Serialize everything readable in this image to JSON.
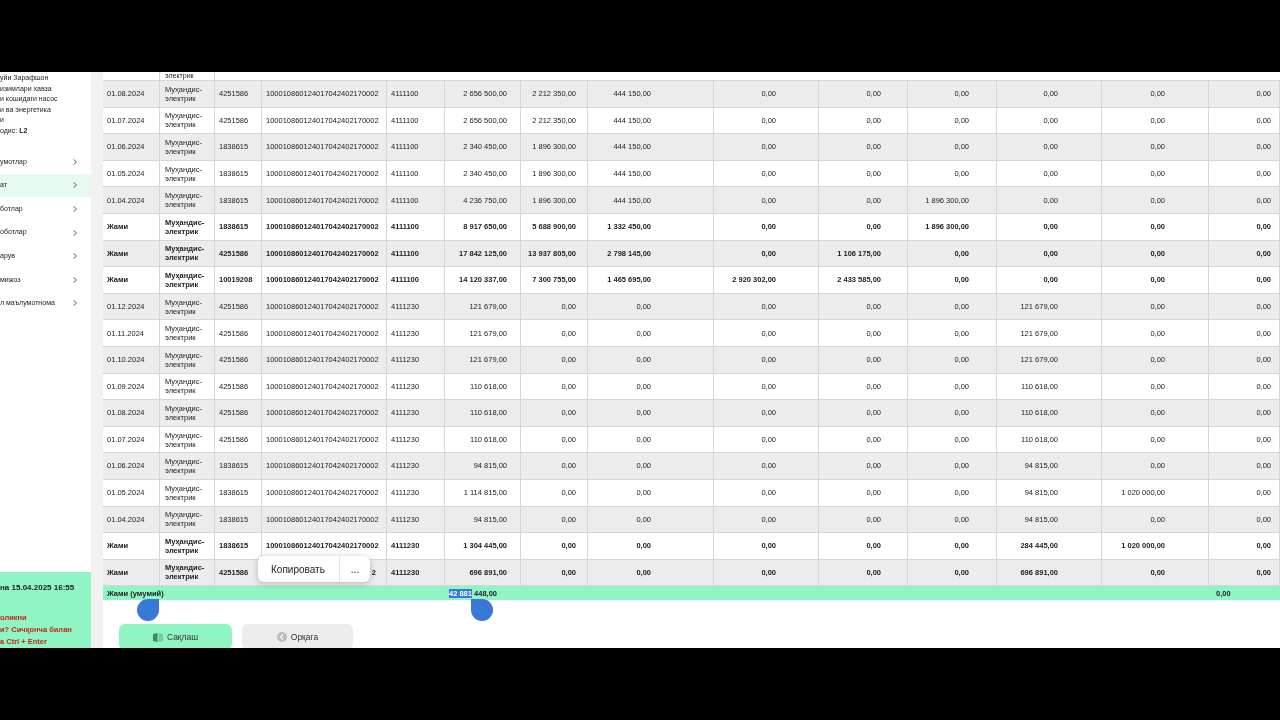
{
  "sidebar": {
    "header_lines": [
      "уйи Зарафшон",
      "изимлари хавза",
      "и кошидаги насос",
      "и ва энергетика",
      "и",
      "одис: **L2**"
    ],
    "items": [
      {
        "label": "умотлар",
        "selected": false
      },
      {
        "label": "ат",
        "selected": true
      },
      {
        "label": "ботлар",
        "selected": false
      },
      {
        "label": "оботлар",
        "selected": false
      },
      {
        "label": "арув",
        "selected": false
      },
      {
        "label": "мижоз",
        "selected": false
      },
      {
        "label": "л маълумотнома",
        "selected": false
      }
    ],
    "footer": {
      "timestamp": "на 15.04.2025 16:55",
      "hint_lines": [
        "оликни",
        "и? Сичқонча билан",
        "а Ctrl + Enter"
      ]
    }
  },
  "table": {
    "top_fragment": "электрик",
    "rows": [
      {
        "date": "01.08.2024",
        "position": "Муҳандис-электрик",
        "id": "4251586",
        "account": "100010860124017042402170002",
        "code": "4111100",
        "bold": false,
        "values": [
          "2 656 500,00",
          "2 212 350,00",
          "444 150,00",
          "0,00",
          "0,00",
          "0,00",
          "0,00",
          "0,00",
          "0,00"
        ]
      },
      {
        "date": "01.07.2024",
        "position": "Муҳандис-электрик",
        "id": "4251586",
        "account": "100010860124017042402170002",
        "code": "4111100",
        "bold": false,
        "values": [
          "2 656 500,00",
          "2 212 350,00",
          "444 150,00",
          "0,00",
          "0,00",
          "0,00",
          "0,00",
          "0,00",
          "0,00"
        ]
      },
      {
        "date": "01.06.2024",
        "position": "Муҳандис-электрик",
        "id": "1838615",
        "account": "100010860124017042402170002",
        "code": "4111100",
        "bold": false,
        "values": [
          "2 340 450,00",
          "1 896 300,00",
          "444 150,00",
          "0,00",
          "0,00",
          "0,00",
          "0,00",
          "0,00",
          "0,00"
        ]
      },
      {
        "date": "01.05.2024",
        "position": "Муҳандис-электрик",
        "id": "1838615",
        "account": "100010860124017042402170002",
        "code": "4111100",
        "bold": false,
        "values": [
          "2 340 450,00",
          "1 896 300,00",
          "444 150,00",
          "0,00",
          "0,00",
          "0,00",
          "0,00",
          "0,00",
          "0,00"
        ]
      },
      {
        "date": "01.04.2024",
        "position": "Муҳандис-электрик",
        "id": "1838615",
        "account": "100010860124017042402170002",
        "code": "4111100",
        "bold": false,
        "values": [
          "4 236 750,00",
          "1 896 300,00",
          "444 150,00",
          "0,00",
          "0,00",
          "1 896 300,00",
          "0,00",
          "0,00",
          "0,00"
        ]
      },
      {
        "date": "Жами",
        "position": "Муҳандис-электрик",
        "id": "1838615",
        "account": "100010860124017042402170002",
        "code": "4111100",
        "bold": true,
        "values": [
          "8 917 650,00",
          "5 688 900,00",
          "1 332 450,00",
          "0,00",
          "0,00",
          "1 896 300,00",
          "0,00",
          "0,00",
          "0,00"
        ]
      },
      {
        "date": "Жами",
        "position": "Муҳандис-электрик",
        "id": "4251586",
        "account": "100010860124017042402170002",
        "code": "4111100",
        "bold": true,
        "values": [
          "17 842 125,00",
          "13 937 805,00",
          "2 798 145,00",
          "0,00",
          "1 106 175,00",
          "0,00",
          "0,00",
          "0,00",
          "0,00"
        ]
      },
      {
        "date": "Жами",
        "position": "Муҳандис-электрик",
        "id": "10019208",
        "account": "100010860124017042402170002",
        "code": "4111100",
        "bold": true,
        "values": [
          "14 120 337,00",
          "7 300 755,00",
          "1 465 695,00",
          "2 920 302,00",
          "2 433 585,00",
          "0,00",
          "0,00",
          "0,00",
          "0,00"
        ]
      },
      {
        "date": "01.12.2024",
        "position": "Муҳандис-электрик",
        "id": "4251586",
        "account": "100010860124017042402170002",
        "code": "4111230",
        "bold": false,
        "values": [
          "121 679,00",
          "0,00",
          "0,00",
          "0,00",
          "0,00",
          "0,00",
          "121 679,00",
          "0,00",
          "0,00"
        ]
      },
      {
        "date": "01.11.2024",
        "position": "Муҳандис-электрик",
        "id": "4251586",
        "account": "100010860124017042402170002",
        "code": "4111230",
        "bold": false,
        "values": [
          "121 679,00",
          "0,00",
          "0,00",
          "0,00",
          "0,00",
          "0,00",
          "121 679,00",
          "0,00",
          "0,00"
        ]
      },
      {
        "date": "01.10.2024",
        "position": "Муҳандис-электрик",
        "id": "4251586",
        "account": "100010860124017042402170002",
        "code": "4111230",
        "bold": false,
        "values": [
          "121 679,00",
          "0,00",
          "0,00",
          "0,00",
          "0,00",
          "0,00",
          "121 679,00",
          "0,00",
          "0,00"
        ]
      },
      {
        "date": "01.09.2024",
        "position": "Муҳандис-электрик",
        "id": "4251586",
        "account": "100010860124017042402170002",
        "code": "4111230",
        "bold": false,
        "values": [
          "110 618,00",
          "0,00",
          "0,00",
          "0,00",
          "0,00",
          "0,00",
          "110 618,00",
          "0,00",
          "0,00"
        ]
      },
      {
        "date": "01.08.2024",
        "position": "Муҳандис-электрик",
        "id": "4251586",
        "account": "100010860124017042402170002",
        "code": "4111230",
        "bold": false,
        "values": [
          "110 618,00",
          "0,00",
          "0,00",
          "0,00",
          "0,00",
          "0,00",
          "110 618,00",
          "0,00",
          "0,00"
        ]
      },
      {
        "date": "01.07.2024",
        "position": "Муҳандис-электрик",
        "id": "4251586",
        "account": "100010860124017042402170002",
        "code": "4111230",
        "bold": false,
        "values": [
          "110 618,00",
          "0,00",
          "0,00",
          "0,00",
          "0,00",
          "0,00",
          "110 618,00",
          "0,00",
          "0,00"
        ]
      },
      {
        "date": "01.06.2024",
        "position": "Муҳандис-электрик",
        "id": "1838615",
        "account": "100010860124017042402170002",
        "code": "4111230",
        "bold": false,
        "values": [
          "94 815,00",
          "0,00",
          "0,00",
          "0,00",
          "0,00",
          "0,00",
          "94 815,00",
          "0,00",
          "0,00"
        ]
      },
      {
        "date": "01.05.2024",
        "position": "Муҳандис-электрик",
        "id": "1838615",
        "account": "100010860124017042402170002",
        "code": "4111230",
        "bold": false,
        "values": [
          "1 114 815,00",
          "0,00",
          "0,00",
          "0,00",
          "0,00",
          "0,00",
          "94 815,00",
          "1 020 000,00",
          "0,00"
        ]
      },
      {
        "date": "01.04.2024",
        "position": "Муҳандис-электрик",
        "id": "1838615",
        "account": "100010860124017042402170002",
        "code": "4111230",
        "bold": false,
        "values": [
          "94 815,00",
          "0,00",
          "0,00",
          "0,00",
          "0,00",
          "0,00",
          "94 815,00",
          "0,00",
          "0,00"
        ]
      },
      {
        "date": "Жами",
        "position": "Муҳандис-электрик",
        "id": "1838615",
        "account": "100010860124017042402170002",
        "code": "4111230",
        "bold": true,
        "values": [
          "1 304 445,00",
          "0,00",
          "0,00",
          "0,00",
          "0,00",
          "0,00",
          "284 445,00",
          "1 020 000,00",
          "0,00"
        ]
      },
      {
        "date": "Жами",
        "position": "Муҳандис-электрик",
        "id": "4251586",
        "account": "2",
        "under_menu": true,
        "code": "4111230",
        "bold": true,
        "values": [
          "696 891,00",
          "0,00",
          "0,00",
          "0,00",
          "0,00",
          "0,00",
          "696 891,00",
          "0,00",
          "0,00"
        ]
      }
    ],
    "total": {
      "label": "Жами (умумий)",
      "amount_selected": "42 881",
      "amount_rest": "448,00",
      "last": "0,00"
    }
  },
  "context_menu": {
    "items": [
      "Копировать",
      "..."
    ]
  },
  "buttons": [
    {
      "kind": "save",
      "label": "Сақлаш"
    },
    {
      "kind": "back",
      "label": "Орқага"
    }
  ]
}
